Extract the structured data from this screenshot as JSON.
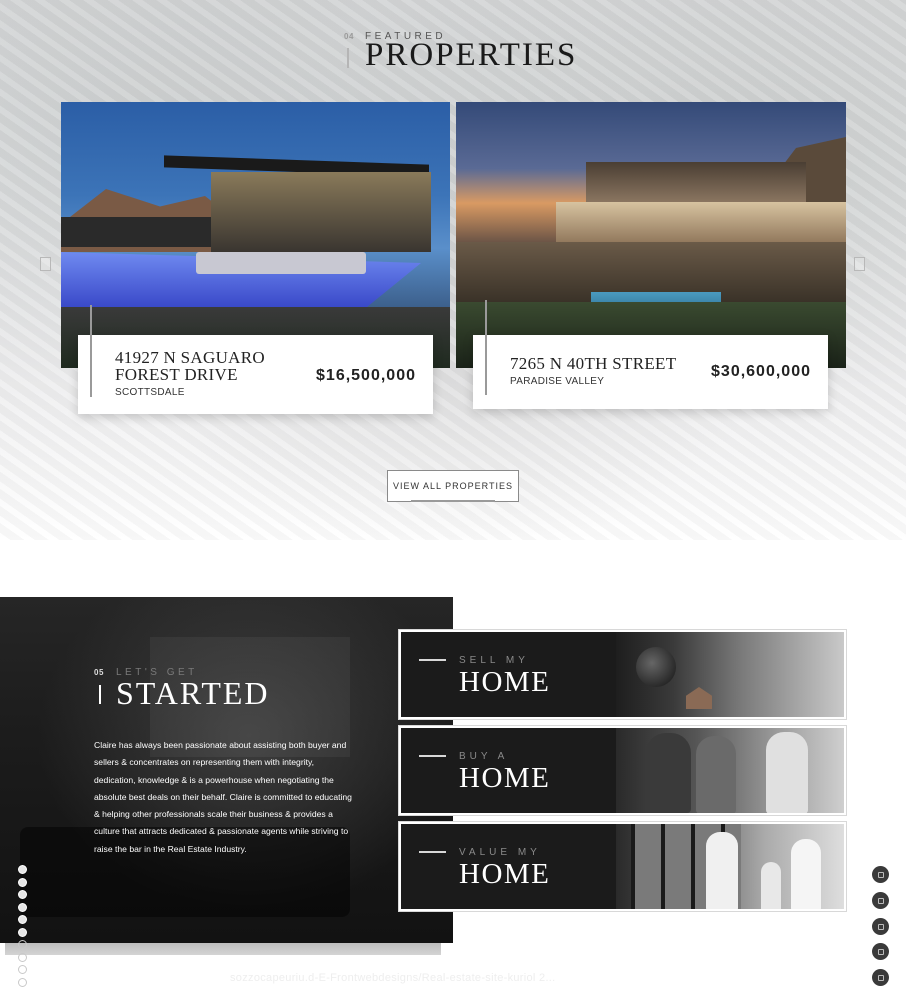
{
  "featured": {
    "number": "04",
    "eyebrow": "FEATURED",
    "title": "PROPERTIES",
    "properties": [
      {
        "address_line1": "41927 N SAGUARO",
        "address_line2": "FOREST DRIVE",
        "city": "SCOTTSDALE",
        "price": "$16,500,000"
      },
      {
        "address_line1": "7265 N 40TH STREET",
        "address_line2": "",
        "city": "PARADISE VALLEY",
        "price": "$30,600,000"
      }
    ],
    "view_all_label": "VIEW ALL PROPERTIES"
  },
  "started": {
    "number": "05",
    "eyebrow": "LET'S GET",
    "title": "STARTED",
    "body": "Claire has always been passionate about assisting both buyer and sellers & concentrates on representing them with integrity, dedication, knowledge & is a powerhouse when negotiating the absolute best deals on their behalf. Claire is committed to educating & helping other professionals scale their business & provides a culture that attracts dedicated & passionate agents while striving to raise the bar in the Real Estate Industry."
  },
  "ctas": [
    {
      "eyebrow": "SELL MY",
      "title": "HOME"
    },
    {
      "eyebrow": "BUY A",
      "title": "HOME"
    },
    {
      "eyebrow": "VALUE MY",
      "title": "HOME"
    }
  ],
  "footer": {
    "faint_url": "sozzocapeuriu.d-E-Frontwebdesigns/Real-estate-site-kuriol 2..."
  }
}
